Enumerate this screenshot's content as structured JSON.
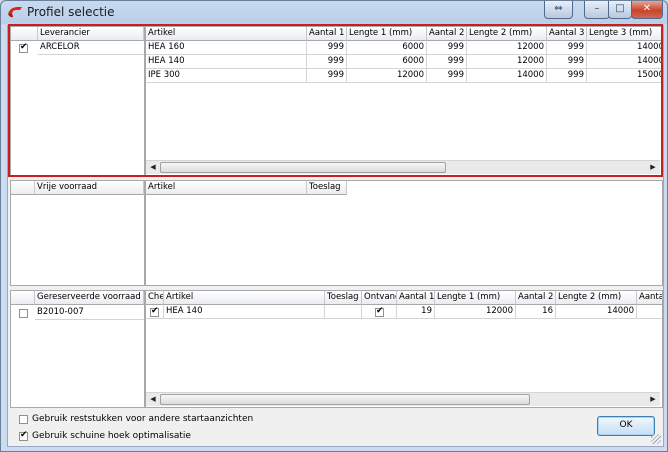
{
  "window": {
    "title": "Profiel selectie",
    "controls": {
      "restore": "⇔",
      "minimize": "–",
      "maximize": "□",
      "close": "✕"
    }
  },
  "suppliers": {
    "header": "Leverancier",
    "rows": [
      {
        "checked": true,
        "name": "ARCELOR"
      }
    ]
  },
  "supplier_articles": {
    "columns": [
      "Artikel",
      "Aantal 1",
      "Lengte 1 (mm)",
      "Aantal 2",
      "Lengte 2 (mm)",
      "Aantal 3",
      "Lengte 3 (mm)"
    ],
    "rows": [
      [
        "HEA  160",
        "999",
        "6000",
        "999",
        "12000",
        "999",
        "14000"
      ],
      [
        "HEA  140",
        "999",
        "6000",
        "999",
        "12000",
        "999",
        "14000"
      ],
      [
        "IPE 300",
        "999",
        "12000",
        "999",
        "14000",
        "999",
        "15000"
      ]
    ]
  },
  "free_stock": {
    "header": "Vrije voorraad",
    "columns": [
      "Artikel",
      "Toeslag"
    ]
  },
  "reserved_stock": {
    "header": "Gereserveerde voorraad",
    "rows": [
      {
        "checked": false,
        "name": "B2010-007"
      }
    ]
  },
  "reserved_articles": {
    "columns": [
      "Che",
      "Artikel",
      "Toeslag",
      "Ontvang",
      "Aantal 1",
      "Lengte 1 (mm)",
      "Aantal 2",
      "Lengte 2 (mm)",
      "Aanta"
    ],
    "rows": [
      {
        "checked": true,
        "artikel": "HEA  140",
        "toeslag": "",
        "ontvangen": true,
        "aantal1": "19",
        "lengte1": "12000",
        "aantal2": "16",
        "lengte2": "14000"
      }
    ]
  },
  "options": {
    "use_offcuts": {
      "label": "Gebruik reststukken voor andere startaanzichten",
      "checked": false
    },
    "bevel_optimization": {
      "label": "Gebruik schuine hoek optimalisatie",
      "checked": true
    }
  },
  "buttons": {
    "ok": "OK"
  },
  "colors": {
    "selection_frame": "#c8201e",
    "title_bar": "#c8daf0"
  }
}
